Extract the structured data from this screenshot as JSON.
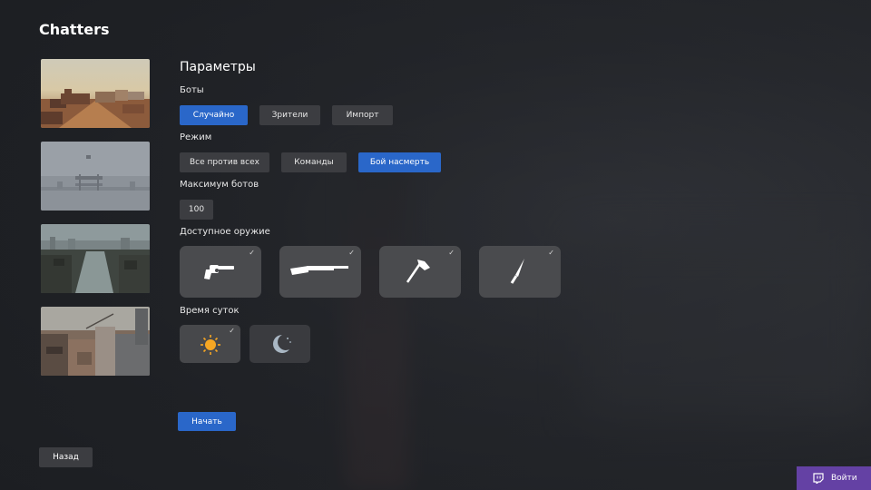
{
  "app": {
    "title": "Chatters"
  },
  "maps": [
    {
      "name": "desert-town"
    },
    {
      "name": "foggy-bridge"
    },
    {
      "name": "river-city"
    },
    {
      "name": "industrial-rooftops"
    }
  ],
  "settings": {
    "title": "Параметры",
    "bots": {
      "label": "Боты",
      "options": [
        "Случайно",
        "Зрители",
        "Импорт"
      ],
      "selected": "Случайно"
    },
    "mode": {
      "label": "Режим",
      "options": [
        "Все против всех",
        "Команды",
        "Бой насмерть"
      ],
      "selected": "Бой насмерть"
    },
    "max_bots": {
      "label": "Максимум ботов",
      "value": "100"
    },
    "weapons": {
      "label": "Доступное оружие",
      "items": [
        {
          "icon": "revolver-icon",
          "checked": true
        },
        {
          "icon": "shotgun-icon",
          "checked": true
        },
        {
          "icon": "axe-icon",
          "checked": true
        },
        {
          "icon": "knife-icon",
          "checked": true
        }
      ],
      "check_glyph": "✓"
    },
    "time_of_day": {
      "label": "Время суток",
      "items": [
        {
          "icon": "sun-icon",
          "checked": true
        },
        {
          "icon": "moon-icon",
          "checked": false
        }
      ]
    }
  },
  "actions": {
    "start": "Начать",
    "back": "Назад",
    "login": "Войти"
  },
  "colors": {
    "accent": "#2a67c9",
    "twitch": "#6441a4",
    "sun": "#f5a623",
    "moon": "#a9b7c4"
  }
}
